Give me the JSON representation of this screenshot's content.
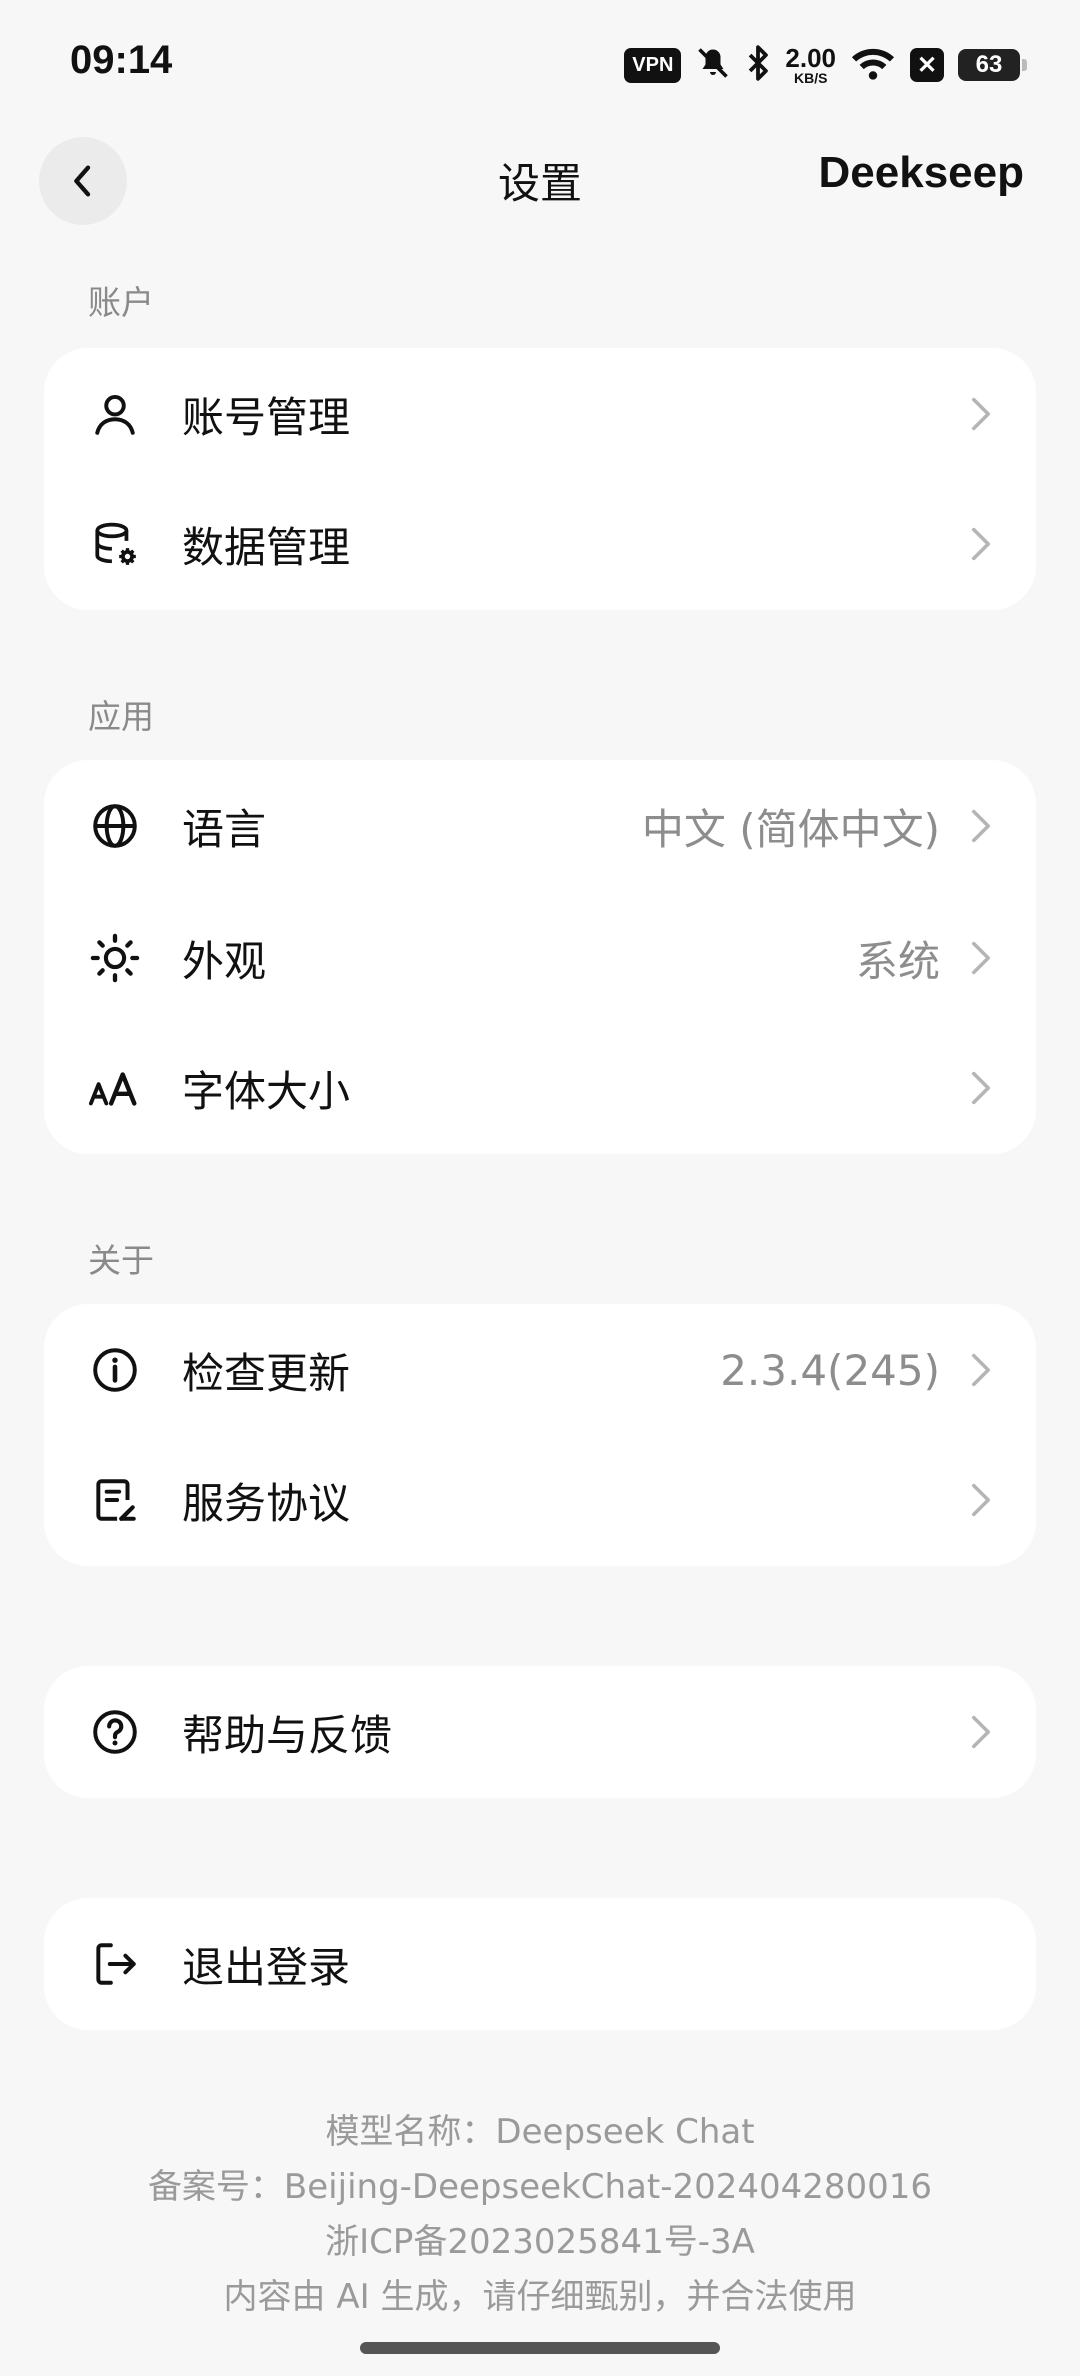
{
  "status": {
    "time": "09:14",
    "vpn": "VPN",
    "net_speed": "2.00",
    "net_unit": "KB/S",
    "battery": "63"
  },
  "header": {
    "title": "设置",
    "brand": "Deekseep"
  },
  "sections": {
    "account": {
      "label": "账户",
      "items": [
        {
          "label": "账号管理",
          "icon": "user-icon"
        },
        {
          "label": "数据管理",
          "icon": "database-settings-icon"
        }
      ]
    },
    "app": {
      "label": "应用",
      "items": [
        {
          "label": "语言",
          "value": "中文 (简体中文)",
          "icon": "globe-icon"
        },
        {
          "label": "外观",
          "value": "系统",
          "icon": "sun-icon"
        },
        {
          "label": "字体大小",
          "icon": "font-size-icon"
        }
      ]
    },
    "about": {
      "label": "关于",
      "items": [
        {
          "label": "检查更新",
          "value": "2.3.4(245)",
          "icon": "info-icon"
        },
        {
          "label": "服务协议",
          "icon": "document-edit-icon"
        }
      ]
    },
    "help": {
      "items": [
        {
          "label": "帮助与反馈",
          "icon": "question-icon"
        }
      ]
    },
    "logout": {
      "items": [
        {
          "label": "退出登录",
          "icon": "logout-icon"
        }
      ]
    }
  },
  "footer": {
    "model": "模型名称：Deepseek Chat",
    "filing": "备案号：Beijing-DeepseekChat-202404280016",
    "icp": "浙ICP备2023025841号-3A",
    "disclaimer": "内容由 AI 生成，请仔细甄别，并合法使用"
  },
  "colors": {
    "background": "#f7f7f7",
    "card": "#ffffff",
    "secondary_text": "#8d8d8d"
  }
}
